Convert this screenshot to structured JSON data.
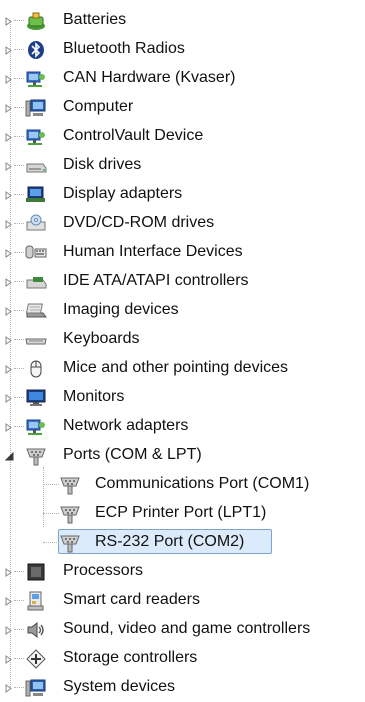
{
  "tree": {
    "categories": [
      {
        "label": "Batteries",
        "icon": "battery-icon",
        "expanded": false
      },
      {
        "label": "Bluetooth Radios",
        "icon": "bluetooth-icon",
        "expanded": false
      },
      {
        "label": "CAN Hardware (Kvaser)",
        "icon": "network-device-icon",
        "expanded": false
      },
      {
        "label": "Computer",
        "icon": "computer-icon",
        "expanded": false
      },
      {
        "label": "ControlVault Device",
        "icon": "network-device-icon",
        "expanded": false
      },
      {
        "label": "Disk drives",
        "icon": "disk-drive-icon",
        "expanded": false
      },
      {
        "label": "Display adapters",
        "icon": "display-adapter-icon",
        "expanded": false
      },
      {
        "label": "DVD/CD-ROM drives",
        "icon": "dvd-drive-icon",
        "expanded": false
      },
      {
        "label": "Human Interface Devices",
        "icon": "hid-icon",
        "expanded": false
      },
      {
        "label": "IDE ATA/ATAPI controllers",
        "icon": "ide-controller-icon",
        "expanded": false
      },
      {
        "label": "Imaging devices",
        "icon": "scanner-icon",
        "expanded": false
      },
      {
        "label": "Keyboards",
        "icon": "keyboard-icon",
        "expanded": false
      },
      {
        "label": "Mice and other pointing devices",
        "icon": "mouse-icon",
        "expanded": false
      },
      {
        "label": "Monitors",
        "icon": "monitor-icon",
        "expanded": false
      },
      {
        "label": "Network adapters",
        "icon": "network-adapter-icon",
        "expanded": false
      },
      {
        "label": "Ports (COM & LPT)",
        "icon": "port-icon",
        "expanded": true,
        "children": [
          {
            "label": "Communications Port (COM1)",
            "icon": "port-icon",
            "selected": false
          },
          {
            "label": "ECP Printer Port (LPT1)",
            "icon": "port-icon",
            "selected": false
          },
          {
            "label": "RS-232 Port (COM2)",
            "icon": "port-icon",
            "selected": true
          }
        ]
      },
      {
        "label": "Processors",
        "icon": "processor-icon",
        "expanded": false
      },
      {
        "label": "Smart card readers",
        "icon": "smart-card-reader-icon",
        "expanded": false
      },
      {
        "label": "Sound, video and game controllers",
        "icon": "speaker-icon",
        "expanded": false
      },
      {
        "label": "Storage controllers",
        "icon": "storage-controller-icon",
        "expanded": false
      },
      {
        "label": "System devices",
        "icon": "system-devices-icon",
        "expanded": false
      }
    ]
  },
  "colors": {
    "selection_fill": "#dcebfc",
    "selection_border": "#7da2ce",
    "tree_lines": "#b4b4b4",
    "expander": "#6e6e6e"
  }
}
